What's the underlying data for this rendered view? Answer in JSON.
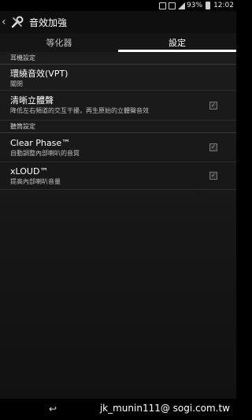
{
  "status_bar": {
    "battery_percent": "93%",
    "time": "12:02"
  },
  "action_bar": {
    "title": "音效加強"
  },
  "tabs": [
    {
      "label": "等化器",
      "active": false
    },
    {
      "label": "設定",
      "active": true
    }
  ],
  "sections": {
    "headphones": "耳機設定",
    "speaker": "聽筒設定"
  },
  "settings": [
    {
      "title": "環繞音效(VPT)",
      "subtitle": "關閉",
      "has_checkbox": false
    },
    {
      "title": "清晰立體聲",
      "subtitle": "降低左右頻道的交互干擾，再生原始的立體聲音效",
      "has_checkbox": true,
      "checked": true
    },
    {
      "title": "Clear Phase™",
      "subtitle": "自動調整內部喇叭的音質",
      "has_checkbox": true,
      "checked": true
    },
    {
      "title": "xLOUD™",
      "subtitle": "提高內部喇叭音量",
      "has_checkbox": true,
      "checked": true
    }
  ],
  "watermark": "jk_munin111@ sogi.com.tw",
  "icons": {
    "back": "chevron-left-icon",
    "app": "tools-icon"
  },
  "colors": {
    "background": "#000000",
    "tab_indicator": "#ffffff"
  }
}
